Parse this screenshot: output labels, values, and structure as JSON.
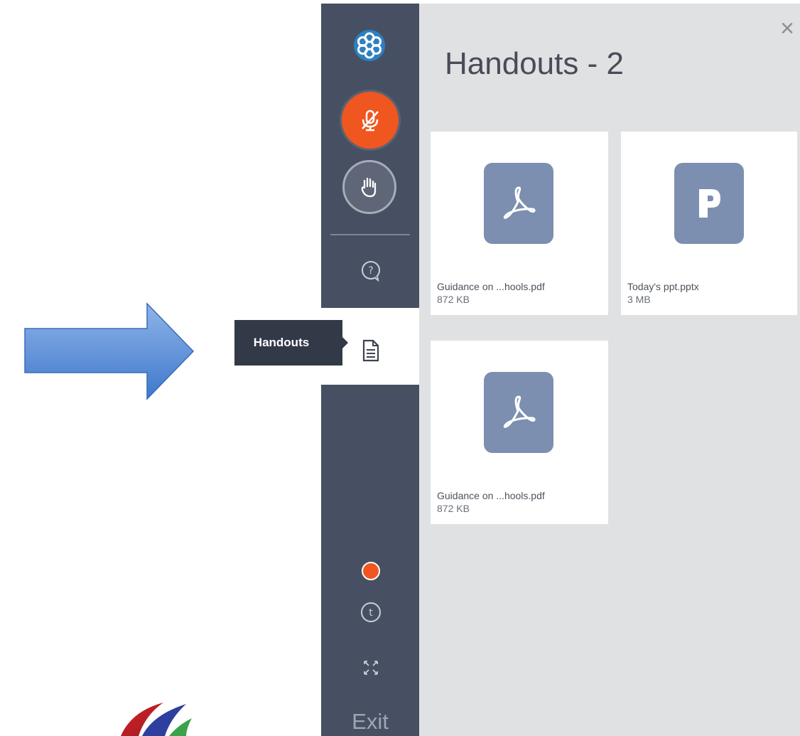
{
  "sidebar": {
    "tooltip": "Handouts",
    "exit_label": "Exit",
    "icons": [
      "logo-icon",
      "mic-muted-icon",
      "raise-hand-icon",
      "question-icon",
      "handouts-icon",
      "record-dot",
      "info-icon",
      "fullscreen-icon"
    ],
    "accent": "#f0561f"
  },
  "panel": {
    "title": "Handouts - 2",
    "close_label": "×"
  },
  "handouts": [
    {
      "name": "Guidance on ...hools.pdf",
      "size": "872 KB",
      "type": "pdf"
    },
    {
      "name": "Today's ppt.pptx",
      "size": "3 MB",
      "type": "pptx"
    },
    {
      "name": "Guidance on ...hools.pdf",
      "size": "872 KB",
      "type": "pdf"
    }
  ]
}
